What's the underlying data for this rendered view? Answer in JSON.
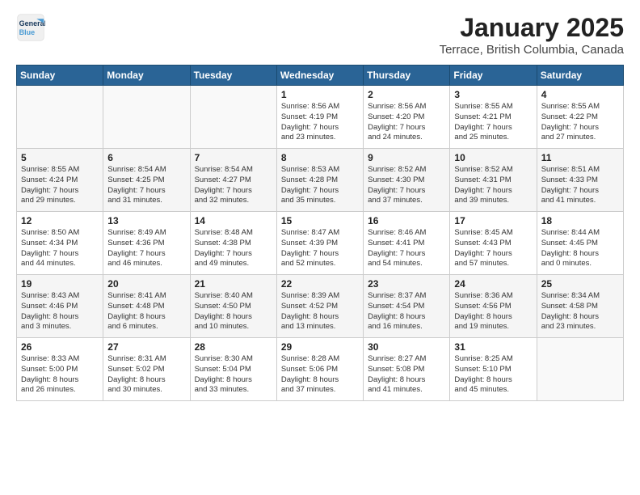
{
  "header": {
    "logo_line1": "General",
    "logo_line2": "Blue",
    "month_year": "January 2025",
    "location": "Terrace, British Columbia, Canada"
  },
  "weekdays": [
    "Sunday",
    "Monday",
    "Tuesday",
    "Wednesday",
    "Thursday",
    "Friday",
    "Saturday"
  ],
  "weeks": [
    [
      {
        "day": "",
        "info": ""
      },
      {
        "day": "",
        "info": ""
      },
      {
        "day": "",
        "info": ""
      },
      {
        "day": "1",
        "info": "Sunrise: 8:56 AM\nSunset: 4:19 PM\nDaylight: 7 hours\nand 23 minutes."
      },
      {
        "day": "2",
        "info": "Sunrise: 8:56 AM\nSunset: 4:20 PM\nDaylight: 7 hours\nand 24 minutes."
      },
      {
        "day": "3",
        "info": "Sunrise: 8:55 AM\nSunset: 4:21 PM\nDaylight: 7 hours\nand 25 minutes."
      },
      {
        "day": "4",
        "info": "Sunrise: 8:55 AM\nSunset: 4:22 PM\nDaylight: 7 hours\nand 27 minutes."
      }
    ],
    [
      {
        "day": "5",
        "info": "Sunrise: 8:55 AM\nSunset: 4:24 PM\nDaylight: 7 hours\nand 29 minutes."
      },
      {
        "day": "6",
        "info": "Sunrise: 8:54 AM\nSunset: 4:25 PM\nDaylight: 7 hours\nand 31 minutes."
      },
      {
        "day": "7",
        "info": "Sunrise: 8:54 AM\nSunset: 4:27 PM\nDaylight: 7 hours\nand 32 minutes."
      },
      {
        "day": "8",
        "info": "Sunrise: 8:53 AM\nSunset: 4:28 PM\nDaylight: 7 hours\nand 35 minutes."
      },
      {
        "day": "9",
        "info": "Sunrise: 8:52 AM\nSunset: 4:30 PM\nDaylight: 7 hours\nand 37 minutes."
      },
      {
        "day": "10",
        "info": "Sunrise: 8:52 AM\nSunset: 4:31 PM\nDaylight: 7 hours\nand 39 minutes."
      },
      {
        "day": "11",
        "info": "Sunrise: 8:51 AM\nSunset: 4:33 PM\nDaylight: 7 hours\nand 41 minutes."
      }
    ],
    [
      {
        "day": "12",
        "info": "Sunrise: 8:50 AM\nSunset: 4:34 PM\nDaylight: 7 hours\nand 44 minutes."
      },
      {
        "day": "13",
        "info": "Sunrise: 8:49 AM\nSunset: 4:36 PM\nDaylight: 7 hours\nand 46 minutes."
      },
      {
        "day": "14",
        "info": "Sunrise: 8:48 AM\nSunset: 4:38 PM\nDaylight: 7 hours\nand 49 minutes."
      },
      {
        "day": "15",
        "info": "Sunrise: 8:47 AM\nSunset: 4:39 PM\nDaylight: 7 hours\nand 52 minutes."
      },
      {
        "day": "16",
        "info": "Sunrise: 8:46 AM\nSunset: 4:41 PM\nDaylight: 7 hours\nand 54 minutes."
      },
      {
        "day": "17",
        "info": "Sunrise: 8:45 AM\nSunset: 4:43 PM\nDaylight: 7 hours\nand 57 minutes."
      },
      {
        "day": "18",
        "info": "Sunrise: 8:44 AM\nSunset: 4:45 PM\nDaylight: 8 hours\nand 0 minutes."
      }
    ],
    [
      {
        "day": "19",
        "info": "Sunrise: 8:43 AM\nSunset: 4:46 PM\nDaylight: 8 hours\nand 3 minutes."
      },
      {
        "day": "20",
        "info": "Sunrise: 8:41 AM\nSunset: 4:48 PM\nDaylight: 8 hours\nand 6 minutes."
      },
      {
        "day": "21",
        "info": "Sunrise: 8:40 AM\nSunset: 4:50 PM\nDaylight: 8 hours\nand 10 minutes."
      },
      {
        "day": "22",
        "info": "Sunrise: 8:39 AM\nSunset: 4:52 PM\nDaylight: 8 hours\nand 13 minutes."
      },
      {
        "day": "23",
        "info": "Sunrise: 8:37 AM\nSunset: 4:54 PM\nDaylight: 8 hours\nand 16 minutes."
      },
      {
        "day": "24",
        "info": "Sunrise: 8:36 AM\nSunset: 4:56 PM\nDaylight: 8 hours\nand 19 minutes."
      },
      {
        "day": "25",
        "info": "Sunrise: 8:34 AM\nSunset: 4:58 PM\nDaylight: 8 hours\nand 23 minutes."
      }
    ],
    [
      {
        "day": "26",
        "info": "Sunrise: 8:33 AM\nSunset: 5:00 PM\nDaylight: 8 hours\nand 26 minutes."
      },
      {
        "day": "27",
        "info": "Sunrise: 8:31 AM\nSunset: 5:02 PM\nDaylight: 8 hours\nand 30 minutes."
      },
      {
        "day": "28",
        "info": "Sunrise: 8:30 AM\nSunset: 5:04 PM\nDaylight: 8 hours\nand 33 minutes."
      },
      {
        "day": "29",
        "info": "Sunrise: 8:28 AM\nSunset: 5:06 PM\nDaylight: 8 hours\nand 37 minutes."
      },
      {
        "day": "30",
        "info": "Sunrise: 8:27 AM\nSunset: 5:08 PM\nDaylight: 8 hours\nand 41 minutes."
      },
      {
        "day": "31",
        "info": "Sunrise: 8:25 AM\nSunset: 5:10 PM\nDaylight: 8 hours\nand 45 minutes."
      },
      {
        "day": "",
        "info": ""
      }
    ]
  ]
}
